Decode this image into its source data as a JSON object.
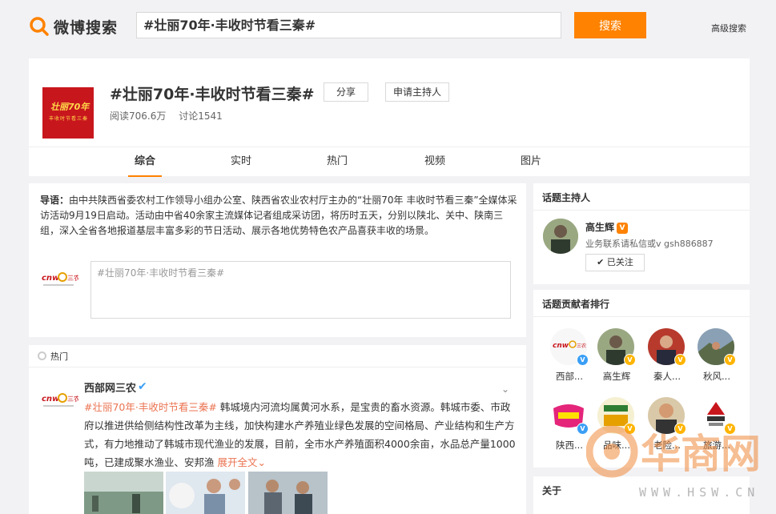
{
  "header": {
    "logo_text": "微博搜索",
    "search_value": "#壮丽70年·丰收时节看三秦#",
    "search_button": "搜索",
    "advanced_search": "高级搜索"
  },
  "topic": {
    "image_text_main": "壮丽70年",
    "image_text_sub": "丰收时节看三秦",
    "title": "#壮丽70年·丰收时节看三秦#",
    "share_label": "分享",
    "apply_host_label": "申请主持人",
    "reads": "阅读706.6万",
    "discussions": "讨论1541",
    "tabs": [
      {
        "label": "综合"
      },
      {
        "label": "实时"
      },
      {
        "label": "热门"
      },
      {
        "label": "视频"
      },
      {
        "label": "图片"
      }
    ]
  },
  "intro": {
    "prefix": "导语：",
    "text": "由中共陕西省委农村工作领导小组办公室、陕西省农业农村厅主办的“壮丽70年 丰收时节看三秦”全媒体采访活动9月19日启动。活动由中省40余家主流媒体记者组成采访团，将历时五天，分别以陕北、关中、陕南三组，深入全省各地报道基层丰富多彩的节日活动、展示各地优势特色农产品喜获丰收的场景。",
    "compose_placeholder": "#壮丽70年·丰收时节看三秦#"
  },
  "feed": {
    "section_label": "热门",
    "post": {
      "author": "西部网三农",
      "hashtag": "#壮丽70年·丰收时节看三秦#",
      "body": "韩城境内河流均属黄河水系，是宝贵的畜水资源。韩城市委、市政府以推进供给侧结构性改革为主线，加快构建水产养殖业绿色发展的空间格局、产业结构和生产方式，有力地推动了韩城市现代渔业的发展，目前，全市水产养殖面积4000余亩，水品总产量1000吨，已建成聚水渔业、安邦渔",
      "expand": "展开全文"
    }
  },
  "sidebar": {
    "host_title": "话题主持人",
    "host_name": "高生辉",
    "host_desc": "业务联系请私信或v gsh886887",
    "follow_label": "已关注",
    "rank_title": "话题贡献者排行",
    "contributors": [
      {
        "name": "西部..."
      },
      {
        "name": "高生辉"
      },
      {
        "name": "秦人..."
      },
      {
        "name": "秋风..."
      },
      {
        "name": "陕西..."
      },
      {
        "name": "品味..."
      },
      {
        "name": "老险..."
      },
      {
        "name": "旅游..."
      }
    ],
    "about_title": "关于"
  },
  "watermark": {
    "brand": "华商网",
    "url": "WWW.HSW.CN"
  },
  "colors": {
    "accent": "#ff8200",
    "link": "#eb7350",
    "verified_blue": "#3a9ff5"
  }
}
